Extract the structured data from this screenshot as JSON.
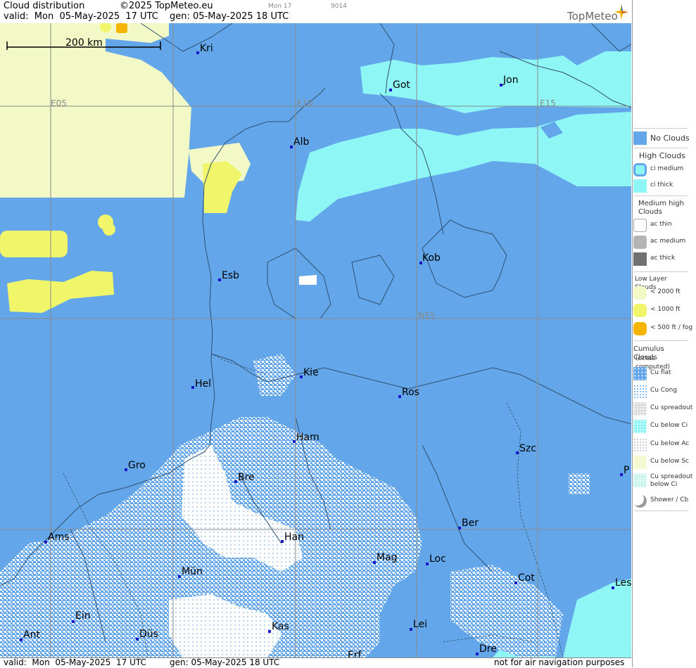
{
  "header": {
    "title": "Cloud distribution",
    "copyright": "©2025 TopMeteo.eu",
    "run": "Mon 17",
    "code": "9014",
    "valid_line": "valid:  Mon  05-May-2025  17 UTC",
    "gen_line": "gen: 05-May-2025 18 UTC",
    "logo": "TopMeteo"
  },
  "scale_bar": {
    "label": "200 km"
  },
  "grid_labels": {
    "e05": "E05",
    "e10": "E10",
    "e15": "E15",
    "n55": "N55"
  },
  "cities": [
    {
      "id": "kri",
      "name": "Kri"
    },
    {
      "id": "got",
      "name": "Got"
    },
    {
      "id": "jon",
      "name": "Jon"
    },
    {
      "id": "alb",
      "name": "Alb"
    },
    {
      "id": "kob",
      "name": "Kob"
    },
    {
      "id": "esb",
      "name": "Esb"
    },
    {
      "id": "kie",
      "name": "Kie"
    },
    {
      "id": "hel",
      "name": "Hel"
    },
    {
      "id": "ros",
      "name": "Ros"
    },
    {
      "id": "ham",
      "name": "Ham"
    },
    {
      "id": "szc",
      "name": "Szc"
    },
    {
      "id": "gro",
      "name": "Gro"
    },
    {
      "id": "bre",
      "name": "Bre"
    },
    {
      "id": "p",
      "name": "P"
    },
    {
      "id": "ber",
      "name": "Ber"
    },
    {
      "id": "ams",
      "name": "Ams"
    },
    {
      "id": "han",
      "name": "Han"
    },
    {
      "id": "mag",
      "name": "Mag"
    },
    {
      "id": "loc",
      "name": "Loc"
    },
    {
      "id": "mun",
      "name": "Mün"
    },
    {
      "id": "cot",
      "name": "Cot"
    },
    {
      "id": "les",
      "name": "Les"
    },
    {
      "id": "ein",
      "name": "Ein"
    },
    {
      "id": "lei",
      "name": "Lei"
    },
    {
      "id": "kas",
      "name": "Kas"
    },
    {
      "id": "ant",
      "name": "Ant"
    },
    {
      "id": "dus",
      "name": "Düs"
    },
    {
      "id": "dre",
      "name": "Dre"
    },
    {
      "id": "erf",
      "name": "Erf"
    }
  ],
  "footer": {
    "valid_line": "valid:  Mon  05-May-2025  17 UTC",
    "gen_line": "gen: 05-May-2025 18 UTC",
    "disclaimer": "not for air navigation purposes"
  },
  "legend": {
    "no_clouds": "No Clouds",
    "high_title": "High Clouds",
    "ci_medium": "ci medium",
    "ci_thick": "ci thick",
    "medium_title": "Medium high Clouds",
    "ac_thin": "ac thin",
    "ac_medium": "ac medium",
    "ac_thick": "ac thick",
    "low_title": "Low Layer Clouds",
    "low_2000": "< 2000 ft",
    "low_1000": "< 1000 ft",
    "low_500": "< 500 ft / fog",
    "cu_title": "Cumulus Clouds",
    "cu_sub": "(octas computed)",
    "cu_flat": "Cu flat",
    "cu_cong": "Cu Cong",
    "cu_spreadout": "Cu spreadout",
    "cu_below_ci": "Cu below Ci",
    "cu_below_ac": "Cu below Ac",
    "cu_below_sc": "Cu below Sc",
    "cu_spreadout_ci_1": "Cu spreadout",
    "cu_spreadout_ci_2": "below Ci",
    "shower": "Shower / Cb"
  },
  "colors": {
    "no_clouds": "#63a7ea",
    "ci": "#8ff6f6",
    "low_2000": "#f2f9c6",
    "low_1000": "#f0f56a",
    "fog": "#f4b400",
    "cumulus": "#ffffff"
  }
}
